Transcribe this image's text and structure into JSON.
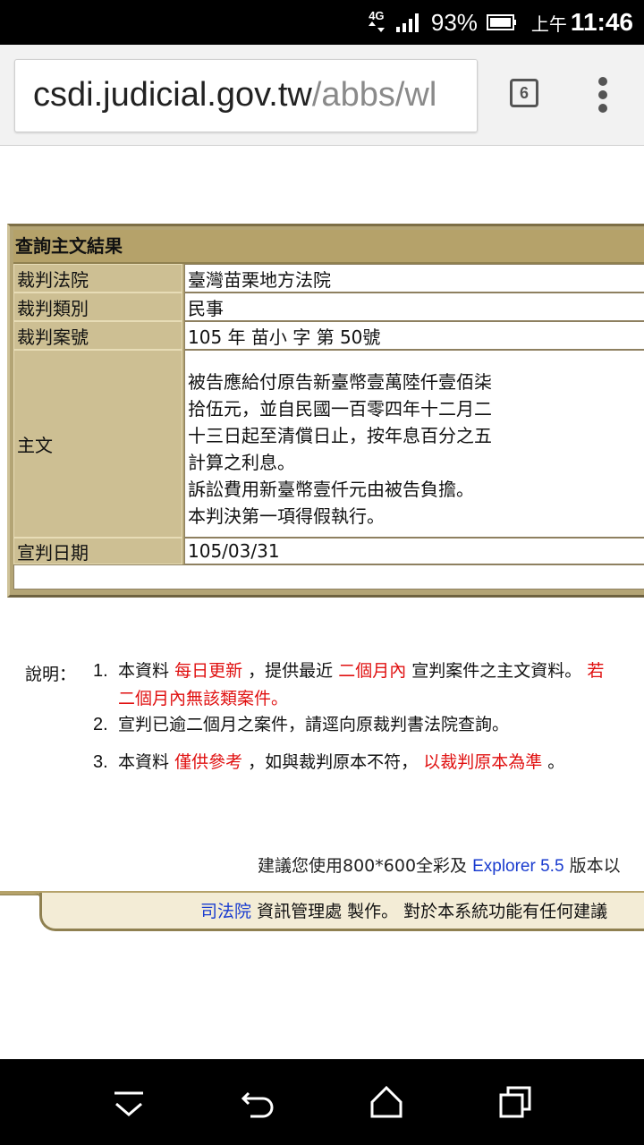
{
  "status_bar": {
    "network": "4G",
    "battery_percent": "93%",
    "time_ampm": "上午",
    "time": "11:46"
  },
  "browser": {
    "url_domain": "csdi.judicial.gov.tw",
    "url_path": "/abbs/wl",
    "tab_count": "6"
  },
  "result": {
    "title": "查詢主文結果",
    "rows": [
      {
        "label": "裁判法院",
        "value": "臺灣苗栗地方法院"
      },
      {
        "label": "裁判類別",
        "value": "民事"
      },
      {
        "label": "裁判案號",
        "value": "105 年 苗小 字 第 50號"
      },
      {
        "label": "主文",
        "value": "被告應給付原告新臺幣壹萬陸仟壹佰柒\n拾伍元，並自民國一百零四年十二月二\n十三日起至清償日止，按年息百分之五\n計算之利息。\n訴訟費用新臺幣壹仟元由被告負擔。\n本判決第一項得假執行。"
      },
      {
        "label": "宣判日期",
        "value": "105/03/31"
      }
    ]
  },
  "notes": {
    "label": "說明：",
    "items": [
      {
        "num": "1.",
        "a": "本資料",
        "b": "每日更新",
        "c": "，提供最近",
        "d": "二個月內",
        "e": "宣判案件之主文資料。",
        "f": "若",
        "g": "二個月內無該類案件。"
      },
      {
        "num": "2.",
        "text": "宣判已逾二個月之案件，請逕向原裁判書法院查詢。"
      },
      {
        "num": "3.",
        "a": "本資料",
        "b": "僅供參考",
        "c": "，如與裁判原本不符，",
        "d": "以裁判原本為準",
        "e": "。"
      }
    ]
  },
  "suggest": {
    "pre": "建議您使用800*600全彩及",
    "link": "Explorer 5.5",
    "post": "版本以"
  },
  "footer": {
    "link": "司法院",
    "text": "資訊管理處 製作。 對於本系統功能有任何建議"
  },
  "colors": {
    "table_frame": "#b3a475",
    "label_cell": "#cdbf93",
    "highlight_red": "#e01010",
    "link_blue": "#1a3ccf"
  }
}
